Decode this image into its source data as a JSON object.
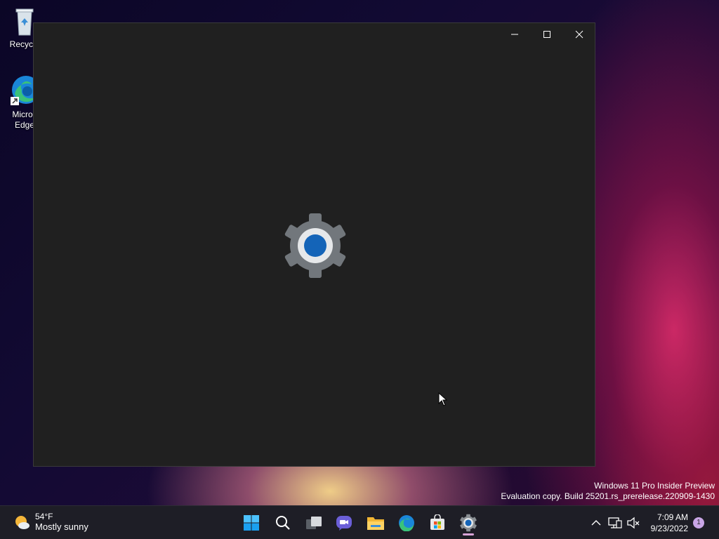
{
  "desktop": {
    "icons": [
      {
        "label": "Recycle",
        "icon": "recycle-bin-icon"
      },
      {
        "label": "Micros Edge",
        "label_line1": "Micros",
        "label_line2": "Edge",
        "icon": "edge-icon"
      }
    ],
    "watermark": {
      "line1": "Windows 11 Pro Insider Preview",
      "line2": "Evaluation copy. Build 25201.rs_prerelease.220909-1430"
    }
  },
  "window": {
    "splash_icon": "settings-gear-icon",
    "controls": {
      "minimize": "minimize-icon",
      "maximize": "maximize-icon",
      "close": "close-icon"
    }
  },
  "taskbar": {
    "weather": {
      "temp": "54°F",
      "condition": "Mostly sunny",
      "icon": "weather-sun-icon"
    },
    "apps": [
      "start-icon",
      "search-icon",
      "task-view-icon",
      "chat-icon",
      "file-explorer-icon",
      "edge-icon",
      "store-icon",
      "settings-icon"
    ],
    "active_app": "settings-icon",
    "tray": [
      "chevron-up-icon",
      "network-icon",
      "volume-muted-icon"
    ],
    "clock": {
      "time": "7:09 AM",
      "date": "9/23/2022"
    },
    "notification_count": "1"
  },
  "colors": {
    "window_bg": "#202020",
    "taskbar_bg": "#1e1e26",
    "accent": "#0f6cbd",
    "gear": "#6e7378"
  }
}
